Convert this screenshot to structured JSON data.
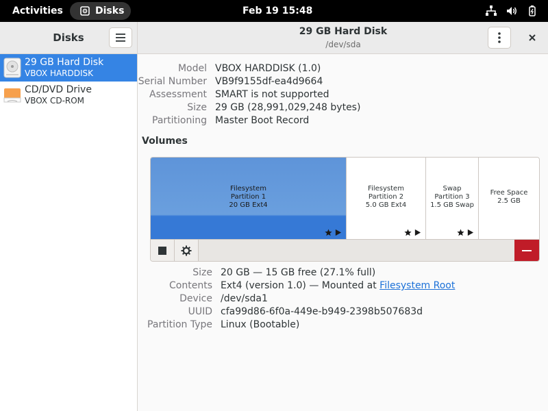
{
  "topbar": {
    "activities": "Activities",
    "app_name": "Disks",
    "clock": "Feb 19  15:48"
  },
  "sidebar": {
    "title": "Disks",
    "drives": [
      {
        "name": "29 GB Hard Disk",
        "sub": "VBOX HARDDISK",
        "icon": "hard-disk-icon",
        "selected": true
      },
      {
        "name": "CD/DVD Drive",
        "sub": "VBOX CD-ROM",
        "icon": "optical-drive-icon",
        "selected": false
      }
    ]
  },
  "header": {
    "title": "29 GB Hard Disk",
    "subtitle": "/dev/sda"
  },
  "disk_props": [
    {
      "label": "Model",
      "value": "VBOX HARDDISK (1.0)"
    },
    {
      "label": "Serial Number",
      "value": "VB9f9155df-ea4d9664"
    },
    {
      "label": "Assessment",
      "value": "SMART is not supported"
    },
    {
      "label": "Size",
      "value": "29 GB (28,991,029,248 bytes)"
    },
    {
      "label": "Partitioning",
      "value": "Master Boot Record"
    }
  ],
  "volumes": {
    "heading": "Volumes",
    "partitions": [
      {
        "line1": "Filesystem",
        "line2": "Partition 1",
        "line3": "20 GB Ext4",
        "selected": true
      },
      {
        "line1": "Filesystem",
        "line2": "Partition 2",
        "line3": "5.0 GB Ext4",
        "selected": false
      },
      {
        "line1": "Swap",
        "line2": "Partition 3",
        "line3": "1.5 GB Swap",
        "selected": false
      },
      {
        "line1": "Free Space",
        "line2": "2.5 GB",
        "line3": "",
        "selected": false
      }
    ]
  },
  "volume_props": [
    {
      "label": "Size",
      "value": "20 GB — 15 GB free (27.1% full)"
    },
    {
      "label": "Contents",
      "value": "Ext4 (version 1.0) — Mounted at ",
      "link": "Filesystem Root"
    },
    {
      "label": "Device",
      "value": "/dev/sda1"
    },
    {
      "label": "UUID",
      "value": "cfa99d86-6f0a-449e-b949-2398b507683d"
    },
    {
      "label": "Partition Type",
      "value": "Linux (Bootable)"
    }
  ],
  "colors": {
    "accent": "#3584e4",
    "danger": "#c01c28",
    "link": "#1c71d8"
  }
}
